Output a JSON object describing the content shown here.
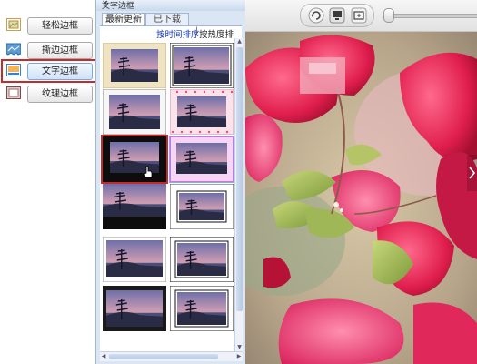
{
  "sidebar": {
    "items": [
      {
        "label": "轻松边框",
        "icon": "easy-frame-icon"
      },
      {
        "label": "撕边边框",
        "icon": "torn-edge-icon"
      },
      {
        "label": "文字边框",
        "icon": "text-frame-icon",
        "active": true
      },
      {
        "label": "纹理边框",
        "icon": "texture-frame-icon"
      }
    ]
  },
  "panel": {
    "title": "文字边框",
    "close": "×",
    "tabs": [
      "最新更新",
      "已下载"
    ],
    "sort_time": "按时间排序",
    "sort_sep": "|",
    "sort_hot": "按热度排序"
  },
  "toolbar": {
    "icons": [
      "refresh-icon",
      "monitor-icon",
      "fit-screen-icon"
    ]
  },
  "colors": {
    "accent_red": "#c62a2a",
    "link_blue": "#1533b5",
    "panel_bg": "#dbe6f4"
  }
}
